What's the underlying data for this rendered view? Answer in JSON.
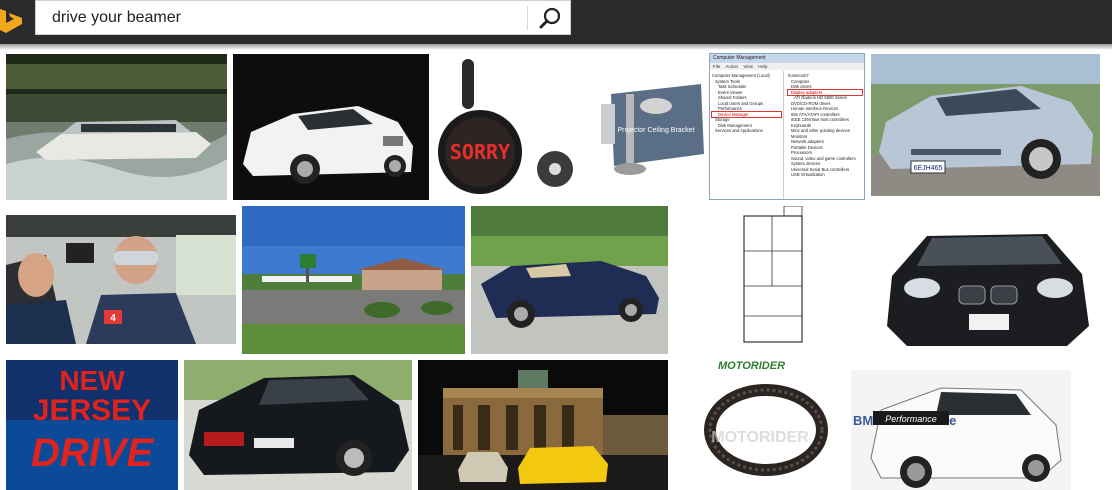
{
  "search": {
    "query": "drive your beamer"
  },
  "colors": {
    "topbar": "#2b2b2b",
    "logo": "#f3a71c"
  },
  "icons": {
    "logo": "bing-logo-icon",
    "search": "magnifier-icon"
  },
  "results": {
    "r1": {
      "desc": "jet boat"
    },
    "r2": {
      "desc": "white BMW sedan"
    },
    "r3": {
      "desc": "LED sign",
      "sign_text": "SORRY"
    },
    "r4": {
      "desc": "ceiling bracket",
      "label": "Projector Ceiling Bracket"
    },
    "r5": {
      "desc": "Computer Management window",
      "title": "Computer Management",
      "menu": [
        "File",
        "Action",
        "View",
        "Help"
      ],
      "tree": [
        "Computer Management (Local)",
        "System Tools",
        "Task Scheduler",
        "Event Viewer",
        "Shared Folders",
        "Local Users and Groups",
        "Performance",
        "Device Manager",
        "Storage",
        "Disk Management",
        "Services and Applications"
      ],
      "devices": [
        "homecom7",
        "Computer",
        "Disk drives",
        "Display adapters",
        "ATI Radeon HD 5800 Series",
        "DVD/CD-ROM drives",
        "Human Interface Devices",
        "IDE ATA/ATAPI controllers",
        "IEEE 1394 Bus host controllers",
        "Keyboards",
        "Mice and other pointing devices",
        "Monitors",
        "Network adapters",
        "Portable Devices",
        "Processors",
        "Sound, video and game controllers",
        "System devices",
        "Universal Serial Bus controllers",
        "USB Virtualization"
      ]
    },
    "r6": {
      "desc": "silver BMW coupe",
      "plate": "6EJH465"
    },
    "r7": {
      "desc": "news crew in car",
      "badge": "4"
    },
    "r8": {
      "desc": "roadside motel"
    },
    "r9": {
      "desc": "blue convertible"
    },
    "r10": {
      "desc": "floor plan"
    },
    "r11": {
      "desc": "black BMW front"
    },
    "r12": {
      "desc": "New Jersey Drive poster",
      "line1": "NEW",
      "line2": "JERSEY",
      "line3": "DRIVE"
    },
    "r13": {
      "desc": "black BMW sedan rear"
    },
    "r14": {
      "desc": "Brandenburg Gate at night"
    },
    "r15": {
      "desc": "drive belt",
      "brand": "MOTORIDER",
      "watermark": "MOTORIDER"
    },
    "r16": {
      "desc": "white BMW 1 series",
      "brand": "BM Performance",
      "overlay": "Performance"
    }
  }
}
